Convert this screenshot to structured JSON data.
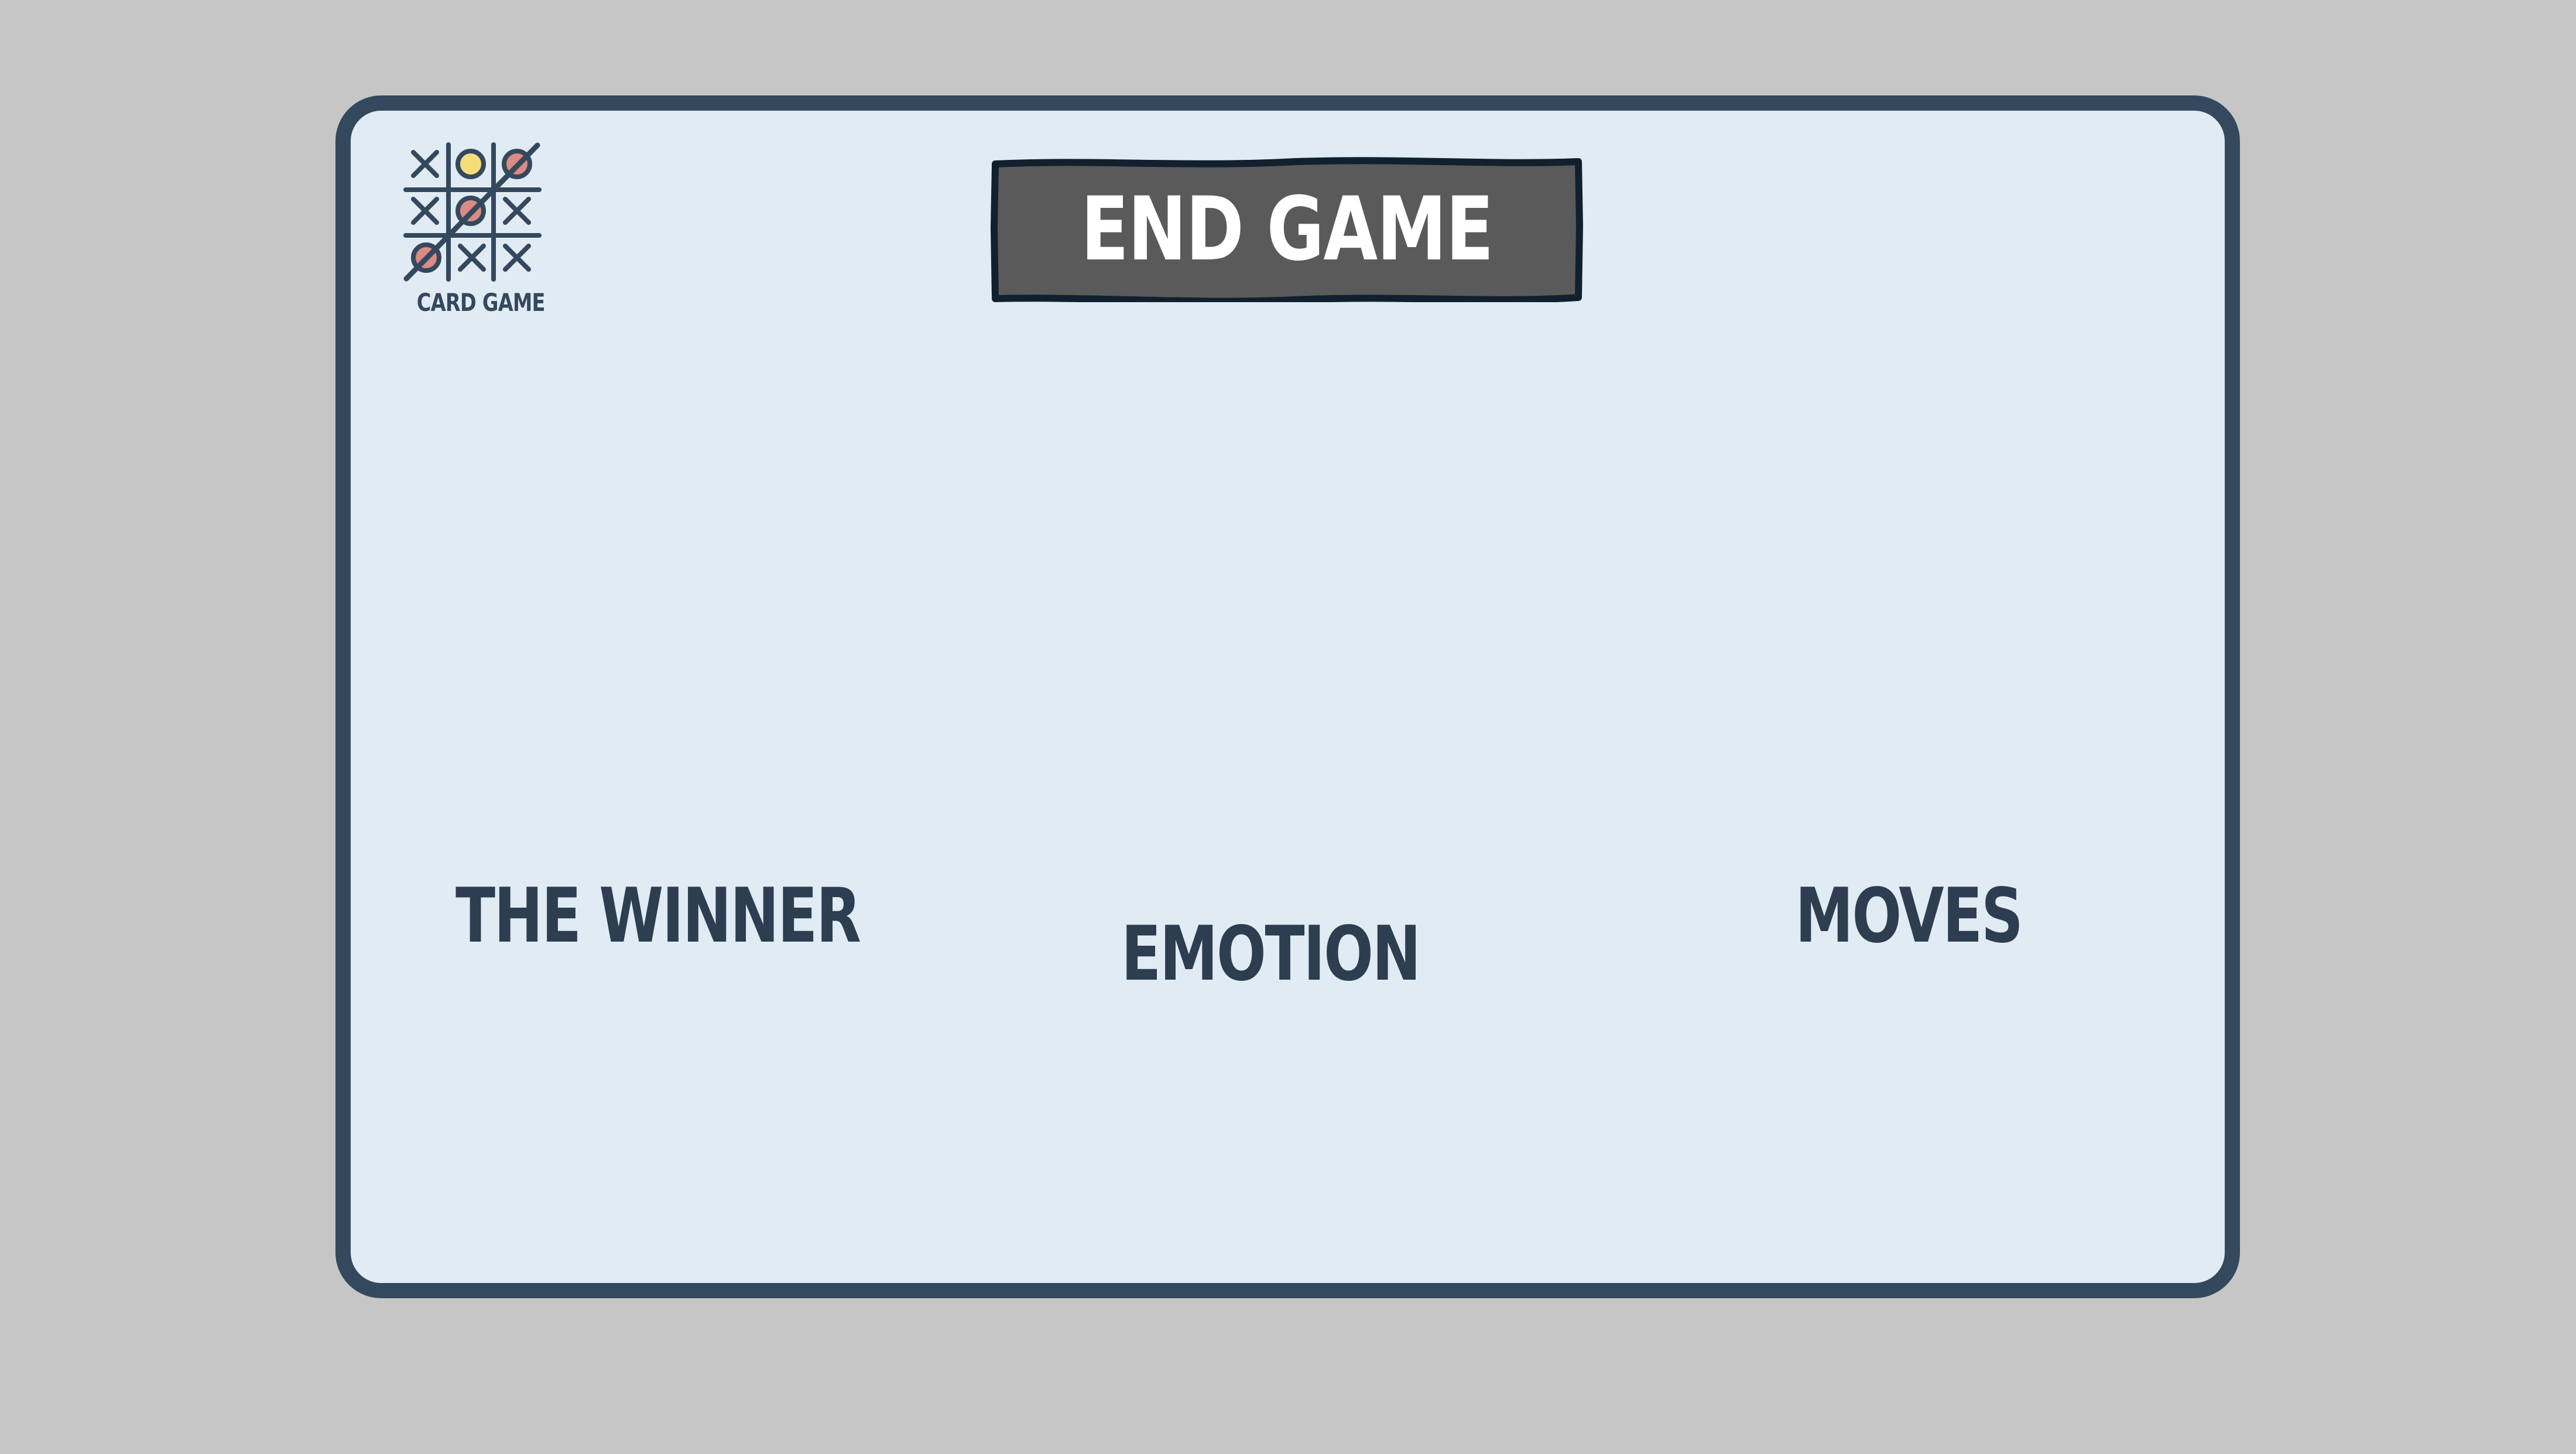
{
  "logo": {
    "icon": "tic-tac-toe-grid-icon",
    "text": "CARD GAME",
    "colors": {
      "stroke": "#34495e",
      "accent_yellow": "#f7dc7a",
      "accent_red": "#d98b84"
    }
  },
  "end_game_button": {
    "label": "END GAME",
    "bg_color": "#5a5a5a",
    "border_color": "#10202e"
  },
  "stats": {
    "winner_label": "THE WINNER",
    "emotion_label": "EMOTION",
    "moves_label": "MOVES"
  },
  "theme": {
    "page_bg": "#c6c6c6",
    "card_bg": "#e1ebf3",
    "card_border": "#34495e",
    "text_color": "#2c3e50"
  }
}
